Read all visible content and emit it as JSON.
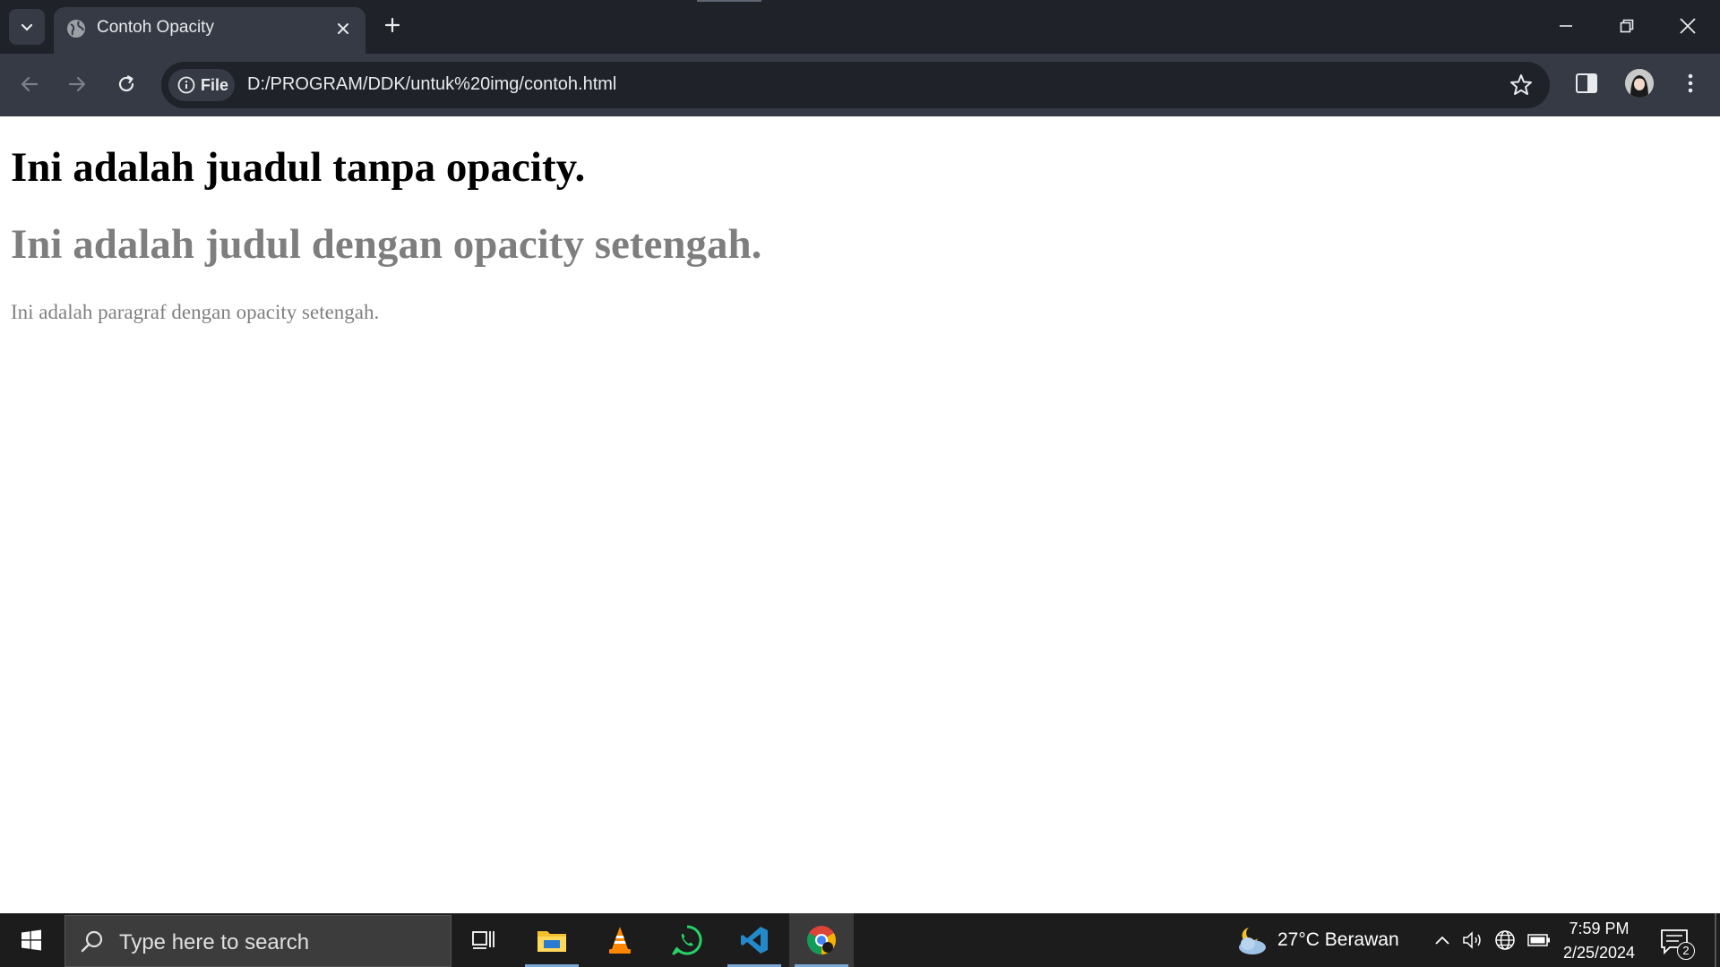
{
  "browser": {
    "tab": {
      "title": "Contoh Opacity"
    },
    "address": {
      "scheme_label": "File",
      "url": "D:/PROGRAM/DDK/untuk%20img/contoh.html"
    }
  },
  "page": {
    "heading_plain": "Ini adalah juadul tanpa opacity.",
    "heading_half": "Ini adalah judul dengan opacity setengah.",
    "paragraph_half": "Ini adalah paragraf dengan opacity setengah."
  },
  "taskbar": {
    "search_placeholder": "Type here to search",
    "weather": "27°C  Berawan",
    "time": "7:59 PM",
    "date": "2/25/2024",
    "notification_count": "2"
  },
  "colors": {
    "chrome_dark": "#1f2229",
    "chrome_toolbar": "#353a44",
    "taskbar": "#1c1c1c"
  }
}
